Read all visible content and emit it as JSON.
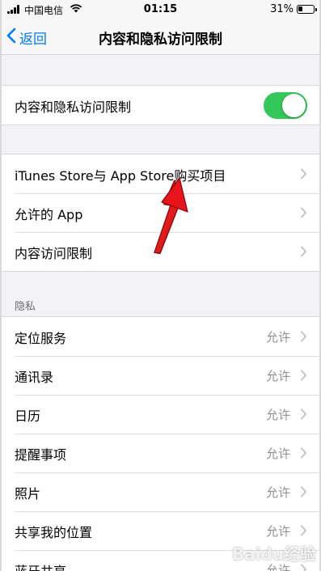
{
  "status_bar": {
    "carrier": "中国电信",
    "time": "01:15",
    "battery_percent_label": "31%",
    "battery_level": 0.31
  },
  "nav": {
    "back_label": "返回",
    "title": "内容和隐私访问限制"
  },
  "restrictions_toggle": {
    "label": "内容和隐私访问限制",
    "state": "on",
    "color": "#34c759"
  },
  "store_section": {
    "items": [
      {
        "label": "iTunes Store与 App Store购买项目"
      },
      {
        "label": "允许的 App"
      },
      {
        "label": "内容访问限制"
      }
    ]
  },
  "privacy_section": {
    "header": "隐私",
    "items": [
      {
        "label": "定位服务",
        "value": "允许"
      },
      {
        "label": "通讯录",
        "value": "允许"
      },
      {
        "label": "日历",
        "value": "允许"
      },
      {
        "label": "提醒事项",
        "value": "允许"
      },
      {
        "label": "照片",
        "value": "允许"
      },
      {
        "label": "共享我的位置",
        "value": "允许"
      },
      {
        "label": "蓝牙共享",
        "value": "允许"
      }
    ]
  },
  "colors": {
    "accent": "#007aff",
    "toggle_on": "#34c759",
    "annotation_arrow": "#e8141b"
  },
  "watermark": "Baidu经验"
}
